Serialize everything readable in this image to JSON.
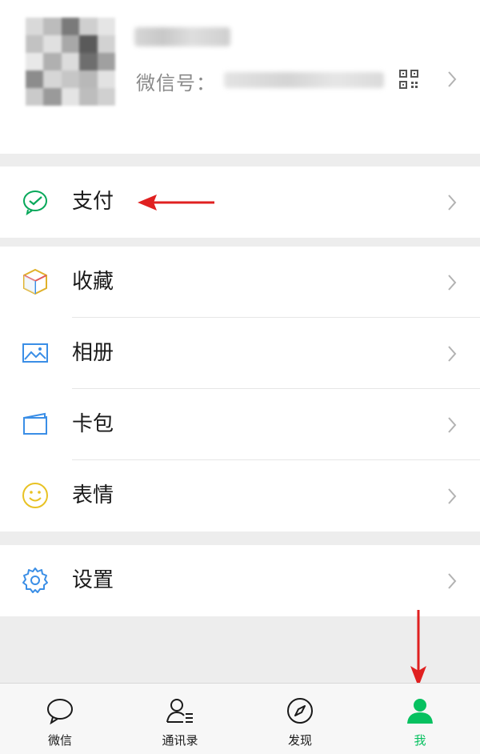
{
  "profile": {
    "wechat_id_label": "微信号："
  },
  "menu": {
    "pay": "支付",
    "favorites": "收藏",
    "album": "相册",
    "cards": "卡包",
    "stickers": "表情",
    "settings": "设置"
  },
  "tabbar": {
    "chats": "微信",
    "contacts": "通讯录",
    "discover": "发现",
    "me": "我"
  },
  "colors": {
    "accent_green": "#07c160",
    "annotation_red": "#e02020",
    "background": "#ededed"
  },
  "icons": [
    "qr-code-icon",
    "chevron-right-icon",
    "wallet-check-icon",
    "cube-icon",
    "picture-icon",
    "card-icon",
    "smiley-icon",
    "gear-icon",
    "chat-bubble-icon",
    "contacts-icon",
    "compass-icon",
    "person-icon"
  ]
}
